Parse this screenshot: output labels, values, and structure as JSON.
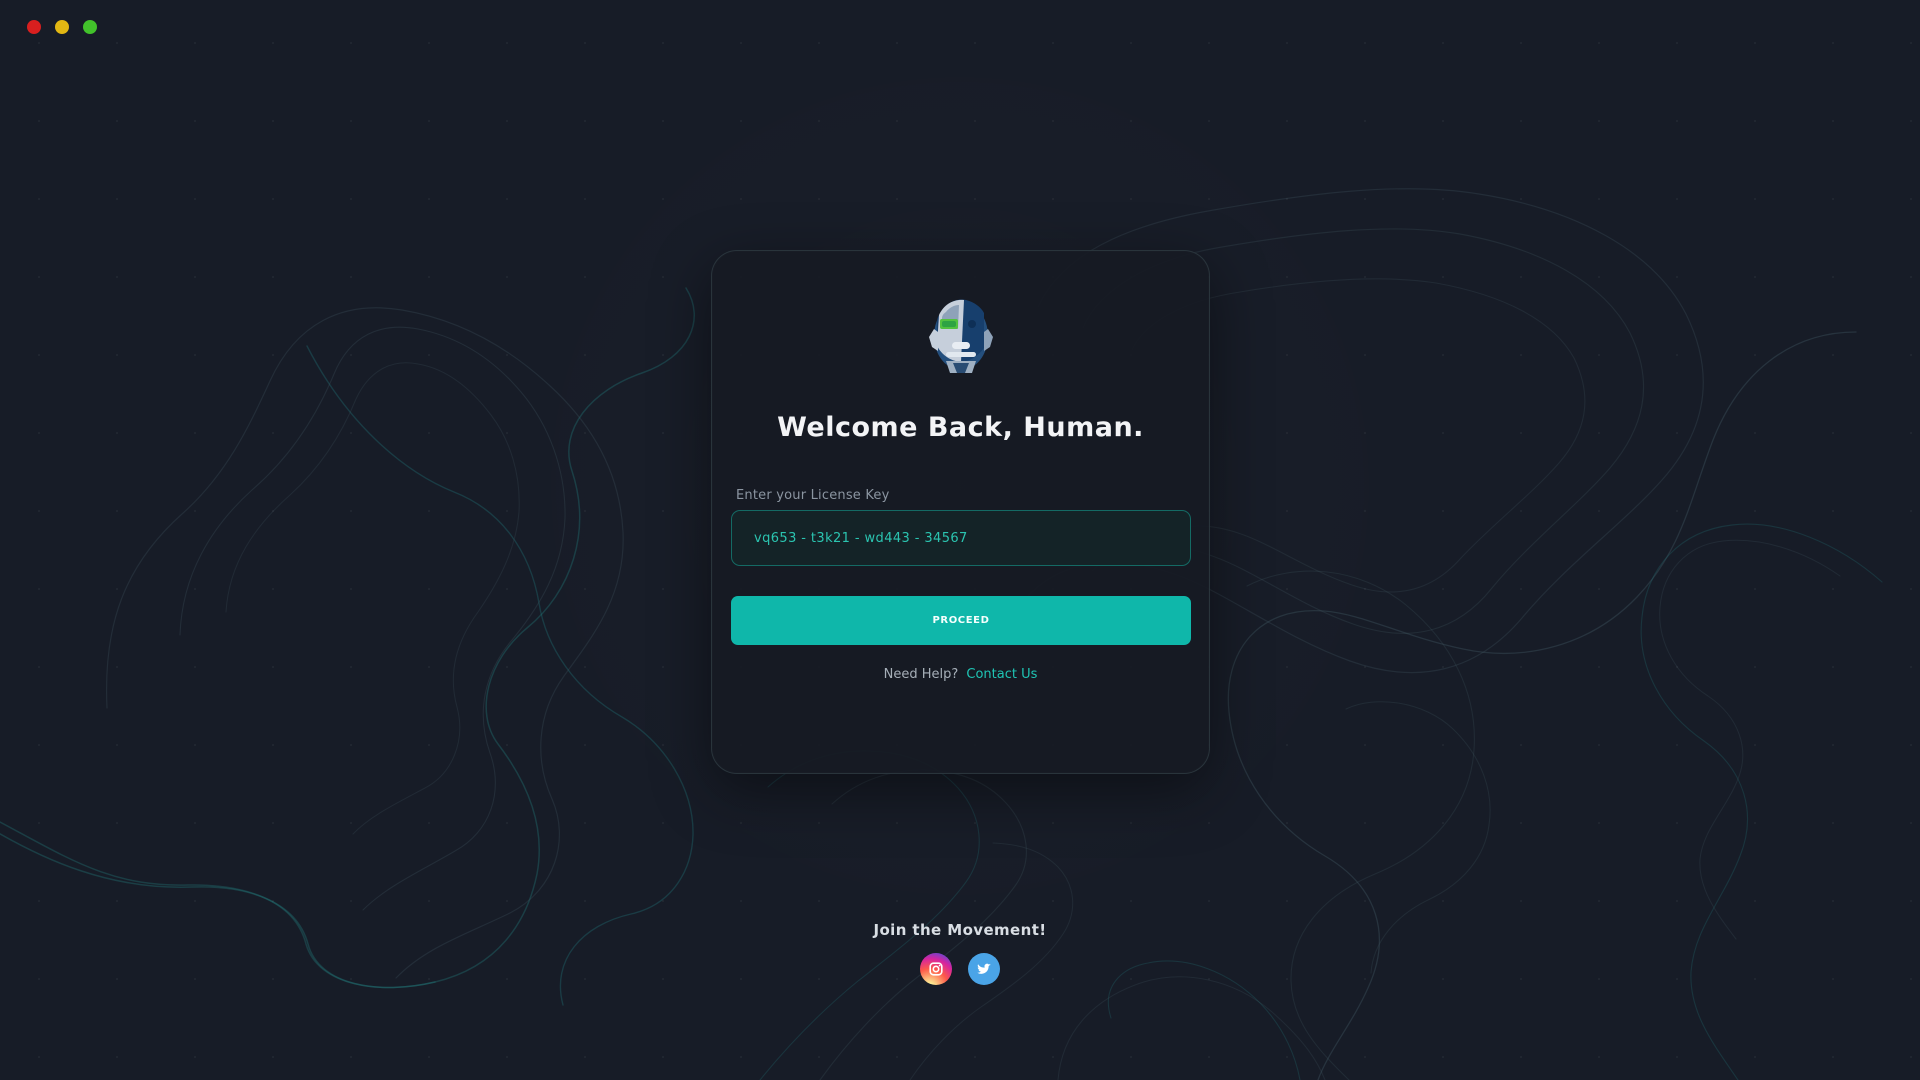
{
  "window_controls": [
    {
      "name": "close-window-button",
      "color": "#d81f1f"
    },
    {
      "name": "minimize-window-button",
      "color": "#e2b713"
    },
    {
      "name": "maximize-window-button",
      "color": "#42c12b"
    }
  ],
  "card": {
    "title": "Welcome Back, Human.",
    "license_label": "Enter your License Key",
    "license_value": "vq653 - t3k21 - wd443 - 34567",
    "proceed_label": "PROCEED",
    "help_prefix": "Need Help?",
    "help_link": "Contact Us"
  },
  "social": {
    "title": "Join the Movement!",
    "icons": [
      "instagram-icon",
      "twitter-icon"
    ]
  },
  "colors": {
    "background": "#171c27",
    "card": "#161b23",
    "accent": "#0fb7aa",
    "input_bg": "#142327",
    "input_text": "#2bc4b0",
    "link": "#1fc4b4",
    "title": "#f3f4f6"
  }
}
